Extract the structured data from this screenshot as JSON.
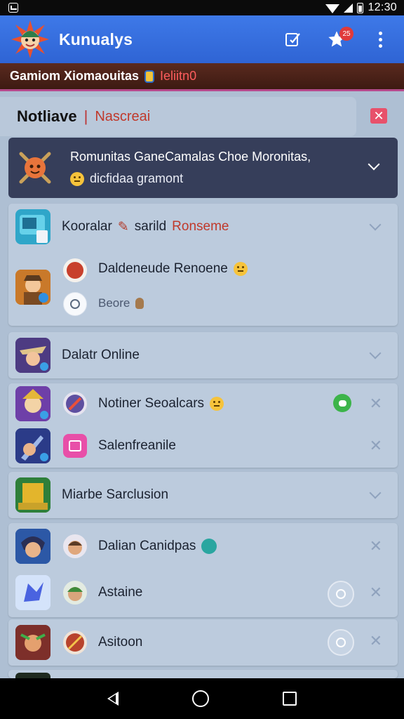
{
  "status_bar": {
    "time": "12:30"
  },
  "app_bar": {
    "title": "Kunualys",
    "badge_count": "25"
  },
  "game_strip": {
    "title": "Gamiom Xiomaouitas",
    "subtitle": "Ieliitn0"
  },
  "notice": {
    "title": "Notliave",
    "separator": "|",
    "subtitle": "Nascreai"
  },
  "featured": {
    "title": "Romunitas GaneCamalas Choe Moronitas,",
    "subtitle": "dicfidaa gramont"
  },
  "groups": [
    {
      "rows": [
        {
          "label": "Kooralar",
          "label_b": "sarild",
          "label_c": "Ronseme"
        },
        {
          "label": "Daldeneude Renoene",
          "secondary": "Beore"
        }
      ]
    },
    {
      "rows": [
        {
          "label": "Dalatr Online"
        }
      ]
    },
    {
      "rows": [
        {
          "label": "Notiner Seoalcars"
        },
        {
          "label": "Salenfreanile"
        }
      ]
    },
    {
      "rows": [
        {
          "label": "Miarbe Sarclusion"
        }
      ]
    },
    {
      "rows": [
        {
          "label": "Dalian Canidpas"
        },
        {
          "label": "Astaine"
        }
      ]
    },
    {
      "rows": [
        {
          "label": "Asitoon"
        }
      ]
    }
  ],
  "colors": {
    "app_bar": "#3e79e8",
    "background": "#aebfd3",
    "featured_card": "#363e5a",
    "accent_red": "#e8516b",
    "online_green": "#3cb44a"
  }
}
